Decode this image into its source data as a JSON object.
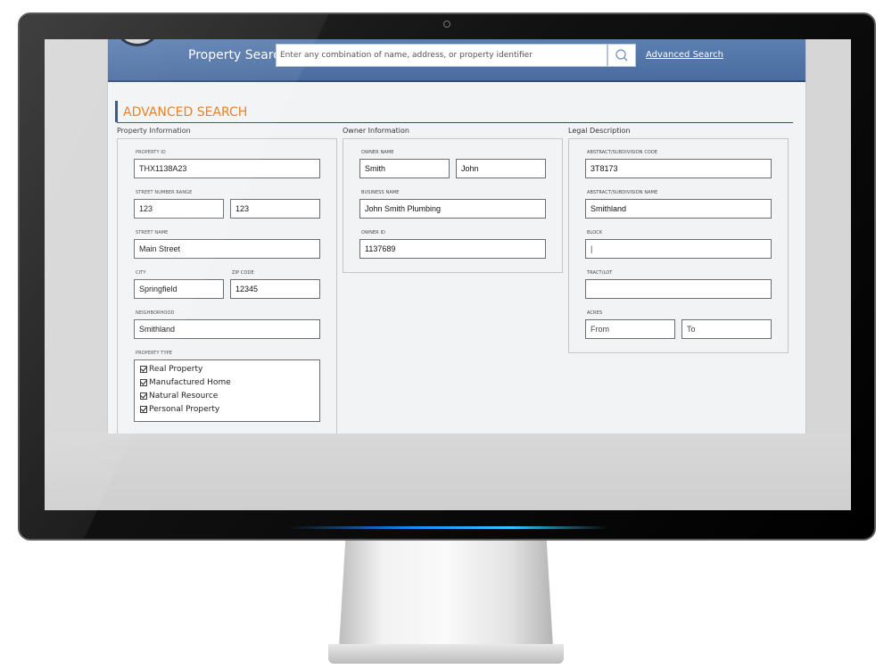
{
  "header": {
    "label": "Property Search",
    "search_placeholder": "Enter any combination of name, address, or property identifier",
    "advanced_link": "Advanced Search"
  },
  "section_title": "ADVANCED SEARCH",
  "columns": {
    "property": "Property Information",
    "owner": "Owner Information",
    "legal": "Legal Description"
  },
  "property": {
    "property_id_label": "PROPERTY ID",
    "property_id": "THX1138A23",
    "street_number_label": "STREET NUMBER RANGE",
    "street_number_from": "123",
    "street_number_to": "123",
    "street_name_label": "STREET NAME",
    "street_name": "Main Street",
    "city_label": "CITY",
    "city": "Springfield",
    "zip_label": "ZIP CODE",
    "zip": "12345",
    "neighborhood_label": "NEIGHBORHOOD",
    "neighborhood": "Smithland",
    "type_label": "PROPERTY TYPE",
    "types": [
      {
        "label": "Real Property",
        "checked": true
      },
      {
        "label": "Manufactured Home",
        "checked": true
      },
      {
        "label": "Natural Resource",
        "checked": true
      },
      {
        "label": "Personal Property",
        "checked": true
      }
    ]
  },
  "owner": {
    "owner_name_label": "OWNER NAME",
    "last_name": "Smith",
    "first_name": "John",
    "business_label": "BUSINESS NAME",
    "business": "John Smith Plumbing",
    "owner_id_label": "OWNER ID",
    "owner_id": "1137689"
  },
  "legal": {
    "abstract_code_label": "ABSTRACT/SUBDIVISION CODE",
    "abstract_code": "3T8173",
    "abstract_name_label": "ABSTRACT/SUBDIVISION NAME",
    "abstract_name": "Smithland",
    "block_label": "BLOCK",
    "block": "|",
    "tract_label": "TRACT/LOT",
    "tract": "",
    "acres_label": "ACRES",
    "acres_from": "From",
    "acres_to": "To"
  }
}
